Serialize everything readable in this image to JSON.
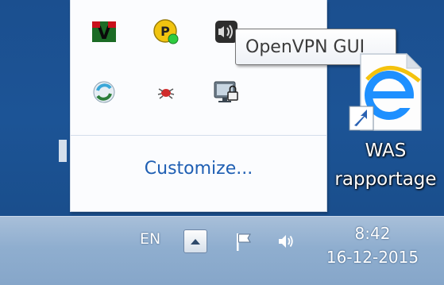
{
  "tray_popup": {
    "icons": [
      {
        "name": "vim-icon"
      },
      {
        "name": "yellow-status-icon"
      },
      {
        "name": "openvpn-icon"
      },
      {
        "name": "sync-icon"
      },
      {
        "name": "bug-icon"
      },
      {
        "name": "network-locked-icon"
      }
    ],
    "customize_label": "Customize..."
  },
  "tooltip": {
    "text": "OpenVPN GUI"
  },
  "desktop": {
    "shortcut": {
      "icon": "internet-explorer-icon",
      "label_line1": "WAS",
      "label_line2": "rapportage"
    }
  },
  "taskbar": {
    "language": "EN",
    "show_hidden_icon": "up-arrow-icon",
    "action_center_icon": "flag-icon",
    "volume_icon": "speaker-icon",
    "clock": {
      "time": "8:42",
      "date": "16-12-2015"
    }
  },
  "colors": {
    "desktop_blue": "#1c5496",
    "popup_bg": "#fbfcfe",
    "link_blue": "#1f5fb3",
    "taskbar": "#8faecf"
  }
}
